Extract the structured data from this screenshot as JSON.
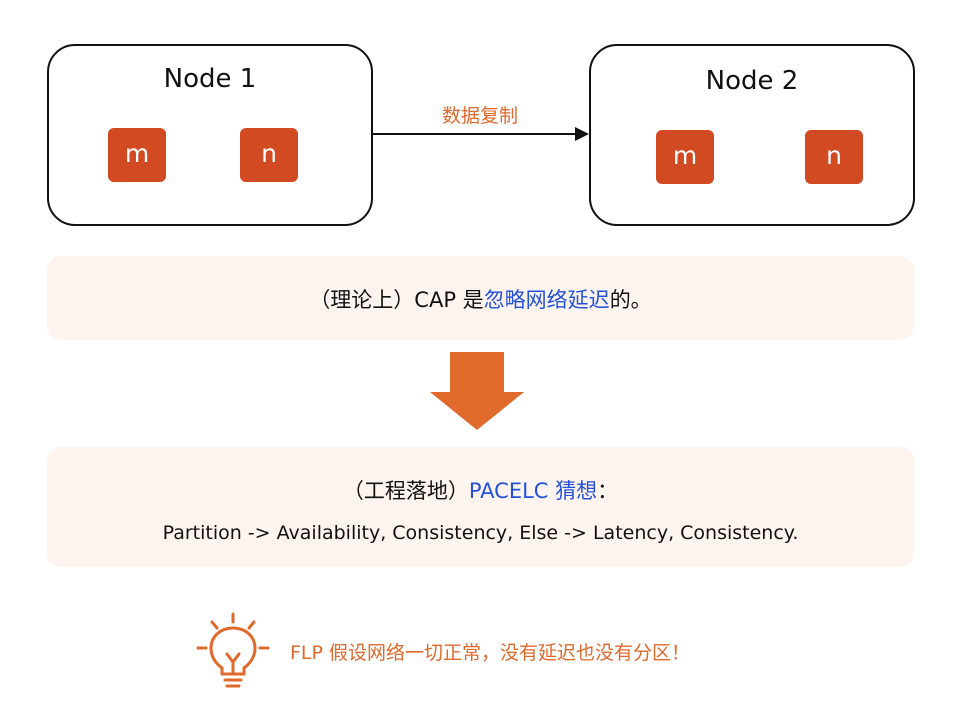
{
  "nodes": [
    {
      "title": "Node 1",
      "items": [
        "m",
        "n"
      ]
    },
    {
      "title": "Node 2",
      "items": [
        "m",
        "n"
      ]
    }
  ],
  "edge_label": "数据复制",
  "cap_note": {
    "prefix": "（理论上）CAP 是",
    "highlight": "忽略网络延迟",
    "suffix": "的。"
  },
  "pacelc": {
    "prefix": "（工程落地）",
    "highlight": "PACELC 猜想",
    "suffix": "：",
    "detail": "Partition -> Availability, Consistency, Else -> Latency, Consistency."
  },
  "tip": {
    "text": "FLP 假设网络一切正常，没有延迟也没有分区！",
    "icon": "lightbulb-icon"
  },
  "colors": {
    "accent": "#e0692c",
    "chip": "#d24a22",
    "highlight": "#2352d8",
    "panel": "#fdf3ef"
  }
}
